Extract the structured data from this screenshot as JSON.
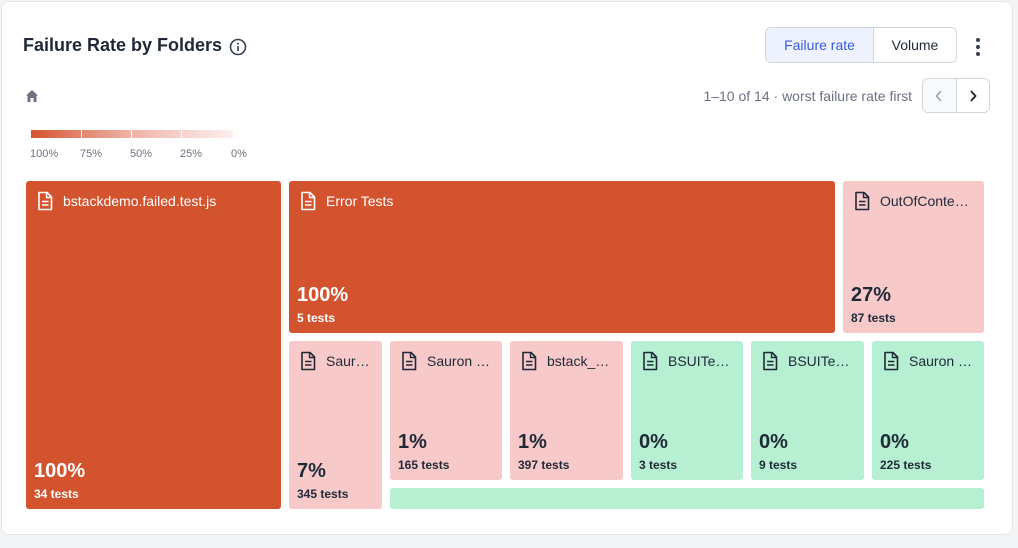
{
  "header": {
    "title": "Failure Rate by Folders",
    "toggle": {
      "active": "Failure rate",
      "inactive": "Volume"
    }
  },
  "paging": {
    "text": "1–10 of 14 · worst failure rate first"
  },
  "legend": {
    "labels": [
      "100%",
      "75%",
      "50%",
      "25%",
      "0%"
    ]
  },
  "colors": {
    "high": "#d4532f",
    "low": "#f7c9c9",
    "zero": "#b7efd2",
    "accent": "#3b5bdb"
  },
  "chart_data": {
    "type": "treemap",
    "items": [
      {
        "name": "bstackdemo.failed.test.js",
        "percent_label": "100%",
        "count_label": "34 tests",
        "failure_rate": 100,
        "tests": 34
      },
      {
        "name": "Error Tests",
        "percent_label": "100%",
        "count_label": "5 tests",
        "failure_rate": 100,
        "tests": 5
      },
      {
        "name": "OutOfConte…",
        "percent_label": "27%",
        "count_label": "87 tests",
        "failure_rate": 27,
        "tests": 87
      },
      {
        "name": "Saur…",
        "percent_label": "7%",
        "count_label": "345 tests",
        "failure_rate": 7,
        "tests": 345
      },
      {
        "name": "Sauron …",
        "percent_label": "1%",
        "count_label": "165 tests",
        "failure_rate": 1,
        "tests": 165
      },
      {
        "name": "bstack_…",
        "percent_label": "1%",
        "count_label": "397 tests",
        "failure_rate": 1,
        "tests": 397
      },
      {
        "name": "BSUITe…",
        "percent_label": "0%",
        "count_label": "3 tests",
        "failure_rate": 0,
        "tests": 3
      },
      {
        "name": "BSUITe…",
        "percent_label": "0%",
        "count_label": "9 tests",
        "failure_rate": 0,
        "tests": 9
      },
      {
        "name": "Sauron …",
        "percent_label": "0%",
        "count_label": "225 tests",
        "failure_rate": 0,
        "tests": 225
      },
      {
        "name": "",
        "percent_label": "",
        "count_label": "",
        "failure_rate": 0,
        "tests": null
      }
    ]
  }
}
